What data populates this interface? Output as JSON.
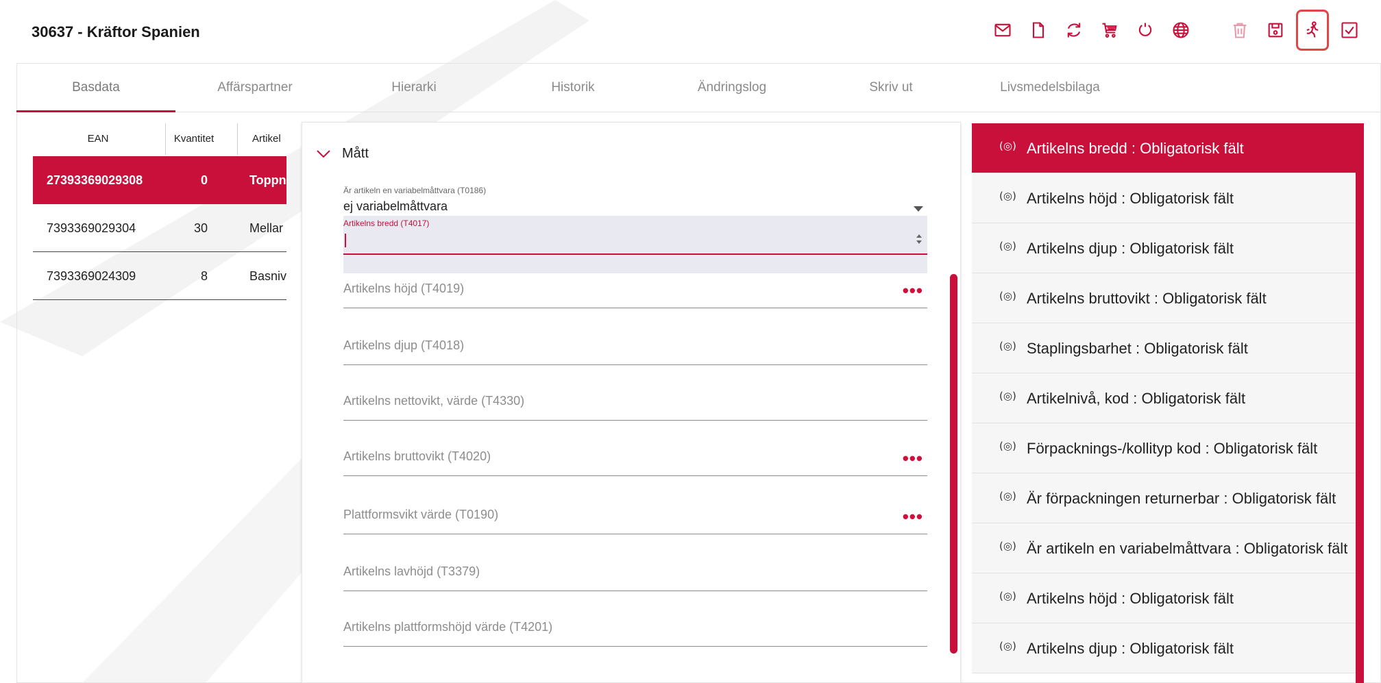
{
  "title": "30637 - Kräftor Spanien",
  "toolbar": {
    "icons": [
      "mail-icon",
      "document-icon",
      "refresh-icon",
      "cart-icon",
      "power-icon",
      "globe-icon",
      "trash-icon",
      "save-icon",
      "run-icon",
      "checkbox-icon"
    ],
    "accent": "#c8103a",
    "active_outline": "#e14545"
  },
  "tabs": [
    {
      "label": "Basdata"
    },
    {
      "label": "Affärspartner"
    },
    {
      "label": "Hierarki"
    },
    {
      "label": "Historik"
    },
    {
      "label": "Ändringslog"
    },
    {
      "label": "Skriv ut"
    },
    {
      "label": "Livsmedelsbilaga"
    }
  ],
  "left_table": {
    "headers": [
      "EAN",
      "Kvantitet",
      "Artikel"
    ],
    "rows": [
      {
        "ean": "27393369029308",
        "qty": "0",
        "art": "Toppn",
        "selected": true
      },
      {
        "ean": "7393369029304",
        "qty": "30",
        "art": "Mellar",
        "selected": false
      },
      {
        "ean": "7393369024309",
        "qty": "8",
        "art": "Basniv",
        "selected": false
      }
    ]
  },
  "form": {
    "section_title": "Mått",
    "variable_label": "Är artikeln en variabelmåttvara (T0186)",
    "variable_value": "ej variabelmåttvara",
    "bredd_label": "Artikelns bredd (T4017)",
    "fields": [
      {
        "label": "Artikelns höjd (T4019)",
        "dots": "•••"
      },
      {
        "label": "Artikelns djup (T4018)",
        "dots": ""
      },
      {
        "label": "Artikelns nettovikt, värde (T4330)",
        "dots": ""
      },
      {
        "label": "Artikelns bruttovikt (T4020)",
        "dots": "•••"
      },
      {
        "label": "Plattformsvikt värde (T0190)",
        "dots": "•••"
      },
      {
        "label": "Artikelns lavhöjd (T3379)",
        "dots": ""
      },
      {
        "label": "Artikelns plattformshöjd värde (T4201)",
        "dots": ""
      }
    ]
  },
  "validation": {
    "icon_glyph": "(◎)",
    "items": [
      {
        "text": "Artikelns bredd : Obligatorisk fält"
      },
      {
        "text": "Artikelns höjd : Obligatorisk fält"
      },
      {
        "text": "Artikelns djup : Obligatorisk fält"
      },
      {
        "text": "Artikelns bruttovikt : Obligatorisk fält"
      },
      {
        "text": "Staplingsbarhet : Obligatorisk fält"
      },
      {
        "text": "Artikelnivå, kod : Obligatorisk fält"
      },
      {
        "text": "Förpacknings-/kollityp kod : Obligatorisk fält"
      },
      {
        "text": "Är förpackningen returnerbar : Obligatorisk fält"
      },
      {
        "text": "Är artikeln en variabelmåttvara : Obligatorisk fält"
      },
      {
        "text": "Artikelns höjd : Obligatorisk fält"
      },
      {
        "text": "Artikelns djup : Obligatorisk fält"
      }
    ]
  }
}
